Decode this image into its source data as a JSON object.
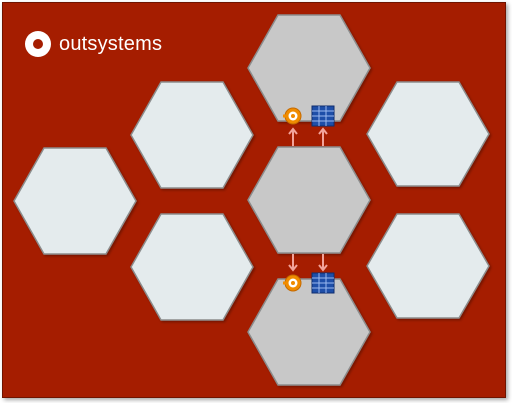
{
  "brand": {
    "logo_text": "outsystems",
    "colors": {
      "background": "#a51d00",
      "hex_light": "#e4ebed",
      "hex_gray": "#c8c8c8",
      "hex_stroke": "#8c8c8c",
      "connector": "#f2a39a"
    }
  },
  "diagram": {
    "hexagons": [
      {
        "name": "hex-left",
        "tone": "light"
      },
      {
        "name": "hex-upper-left",
        "tone": "light"
      },
      {
        "name": "hex-lower-left",
        "tone": "light"
      },
      {
        "name": "hex-top-center",
        "tone": "gray"
      },
      {
        "name": "hex-middle-center",
        "tone": "gray"
      },
      {
        "name": "hex-bottom-center",
        "tone": "gray"
      },
      {
        "name": "hex-upper-right",
        "tone": "light"
      },
      {
        "name": "hex-lower-right",
        "tone": "light"
      }
    ],
    "connector_groups": [
      {
        "name": "connector-group-top",
        "icons": [
          "service-icon",
          "database-icon"
        ]
      },
      {
        "name": "connector-group-bottom",
        "icons": [
          "service-icon",
          "database-icon"
        ]
      }
    ]
  }
}
